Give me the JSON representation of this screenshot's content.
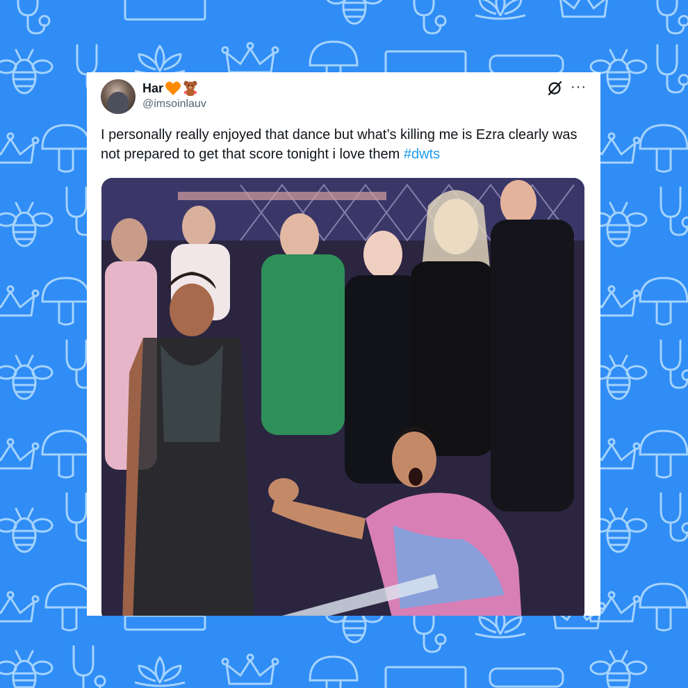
{
  "post": {
    "author": {
      "name": "Har",
      "handle": "@imsoinlauv",
      "emoji": [
        "orange-heart-icon",
        "teddy-bear-icon"
      ]
    },
    "text_before": "I personally really enjoyed that dance but what’s killing me is Ezra clearly was not prepared to get that score tonight i love them ",
    "hashtag": "#dwts",
    "media_description_icon": "photo-dance-studio-audience"
  },
  "colors": {
    "background": "#2f8df5",
    "pattern_line": "#9fd0ff",
    "card": "#ffffff",
    "text": "#0f1419",
    "secondary_text": "#536471",
    "link": "#1d9bf0",
    "heart": "#ff8a00"
  }
}
